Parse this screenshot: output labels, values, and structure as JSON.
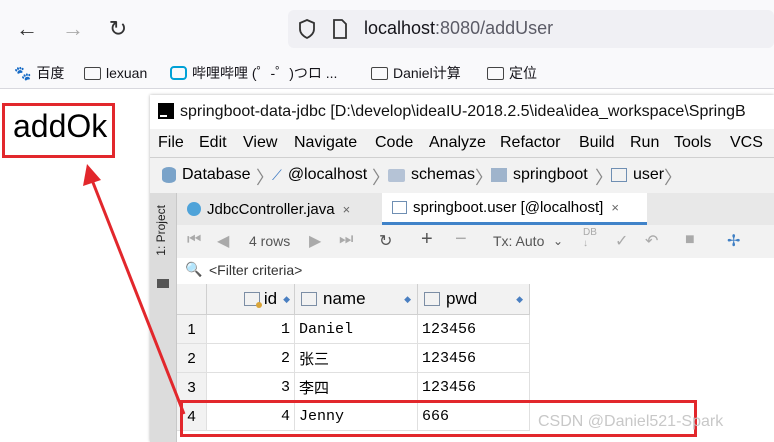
{
  "browser": {
    "url_host": "localhost",
    "url_rest": ":8080/addUser",
    "bookmarks": [
      "百度",
      "lexuan",
      "哔哩哔哩 (゜-゜)つロ ...",
      "Daniel计算",
      "定位"
    ]
  },
  "page": {
    "text": "addOk"
  },
  "ide": {
    "title": "springboot-data-jdbc [D:\\develop\\ideaIU-2018.2.5\\idea\\idea_workspace\\SpringB",
    "menu": [
      "File",
      "Edit",
      "View",
      "Navigate",
      "Code",
      "Analyze",
      "Refactor",
      "Build",
      "Run",
      "Tools",
      "VCS"
    ],
    "breadcrumb": [
      "Database",
      "@localhost",
      "schemas",
      "springboot",
      "user"
    ],
    "side_label": "1: Project",
    "tabs": [
      {
        "label": "JdbcController.java",
        "close": "×"
      },
      {
        "label": "springboot.user [@localhost]",
        "close": "×"
      }
    ],
    "toolbar": {
      "rows": "4 rows",
      "tx": "Tx: Auto"
    },
    "filter_placeholder": "<Filter criteria>",
    "columns": [
      "id",
      "name",
      "pwd"
    ],
    "rows": [
      {
        "n": "1",
        "id": "1",
        "name": "Daniel",
        "pwd": "123456"
      },
      {
        "n": "2",
        "id": "2",
        "name": "张三",
        "pwd": "123456"
      },
      {
        "n": "3",
        "id": "3",
        "name": "李四",
        "pwd": "123456"
      },
      {
        "n": "4",
        "id": "4",
        "name": "Jenny",
        "pwd": "666"
      }
    ]
  },
  "watermark": "CSDN @Daniel521-Spark",
  "colors": {
    "annotation": "#e2272c",
    "tab_accent": "#4083c9"
  }
}
